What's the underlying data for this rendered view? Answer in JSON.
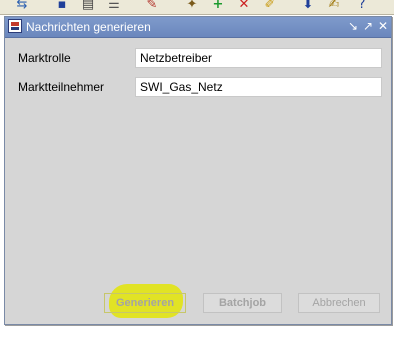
{
  "toolbar": {
    "icons": [
      "nav-arrows-icon",
      "save-icon",
      "print-icon",
      "list-icon",
      "edit-tool-icon",
      "wand-icon",
      "add-icon",
      "delete-icon",
      "brush-icon",
      "download-icon",
      "edit-document-icon",
      "help-icon"
    ]
  },
  "dialog": {
    "title": "Nachrichten generieren",
    "controls": {
      "minimize": "↘",
      "maximize": "↗",
      "close": "✕"
    },
    "fields": {
      "marktrolle": {
        "label": "Marktrolle",
        "value": "Netzbetreiber"
      },
      "marktteilnehmer": {
        "label": "Marktteilnehmer",
        "value": "SWI_Gas_Netz"
      }
    },
    "buttons": {
      "generieren": "Generieren",
      "batchjob": "Batchjob",
      "abbrechen": "Abbrechen"
    }
  },
  "colors": {
    "titlebar": "#7891c5",
    "dialog_background": "#d6d6d6",
    "highlight": "#e1e325",
    "disabled_text": "#a4a4a4"
  }
}
